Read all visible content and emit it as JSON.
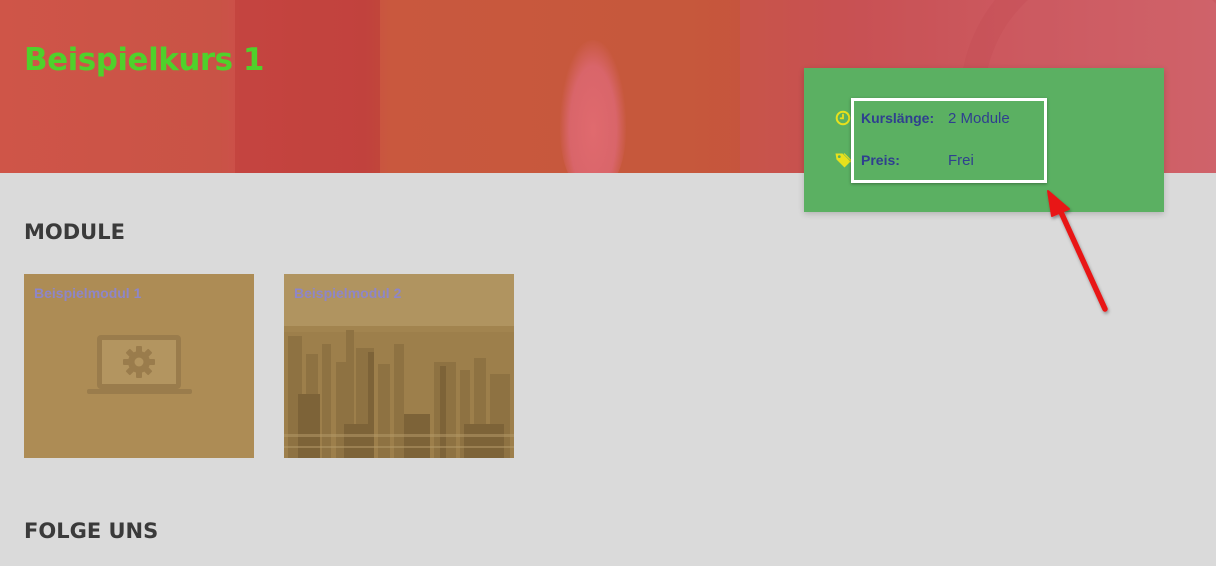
{
  "course": {
    "title": "Beispielkurs 1"
  },
  "info": {
    "rows": [
      {
        "icon": "clock-icon",
        "label": "Kurslänge:",
        "value": "2 Module"
      },
      {
        "icon": "price-tag-icon",
        "label": "Preis:",
        "value": "Frei"
      }
    ]
  },
  "sections": {
    "modules_title": "MODULE",
    "follow_title": "FOLGE UNS"
  },
  "modules": [
    {
      "label": "Beispielmodul 1",
      "image": "laptop-gear-icon"
    },
    {
      "label": "Beispielmodul 2",
      "image": "city-skyline-photo"
    }
  ],
  "colors": {
    "hero": "#c8534a",
    "title": "#4fd12b",
    "info_card": "#5bb062",
    "info_text": "#2f3f8f",
    "icon": "#e8e11c",
    "module_overlay": "#ad8c55",
    "module_label": "#8e86c8",
    "annotation_arrow": "#e81717"
  }
}
